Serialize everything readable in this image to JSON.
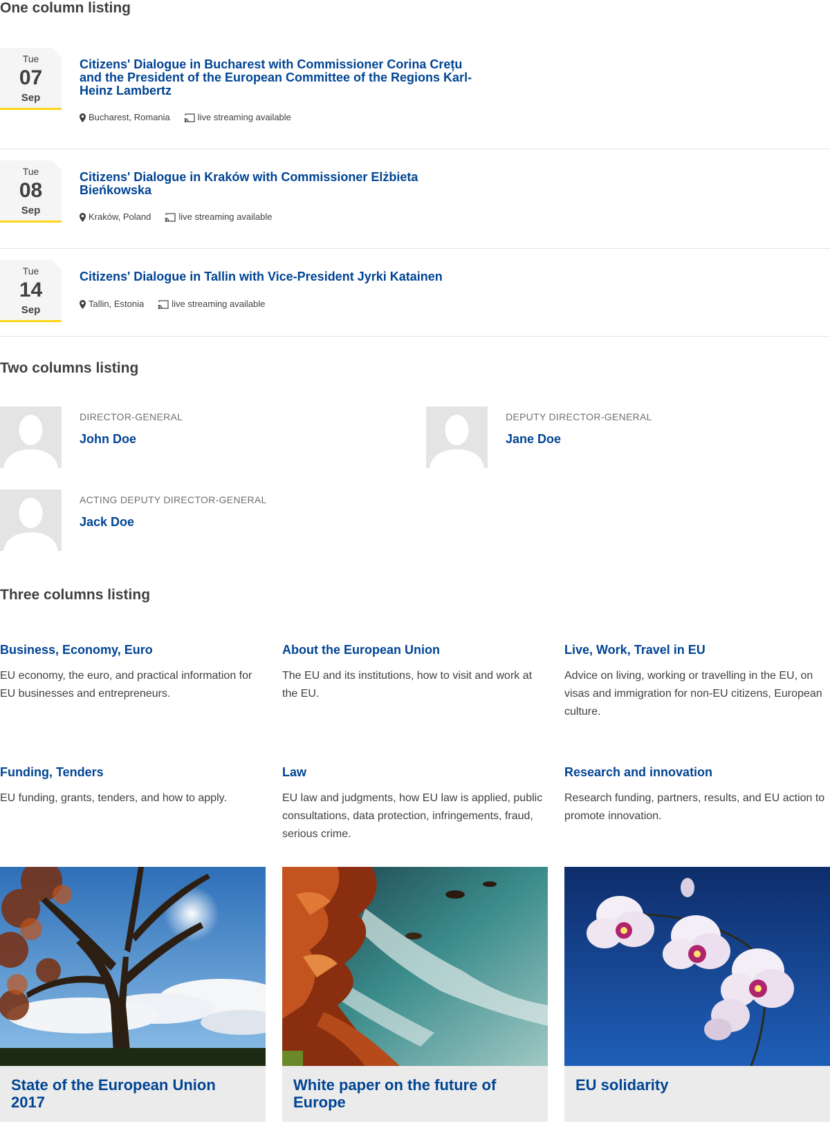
{
  "sections": {
    "one_column": "One column listing",
    "two_columns": "Two columns listing",
    "three_columns": "Three columns listing"
  },
  "events": [
    {
      "dow": "Tue",
      "day": "07",
      "month": "Sep",
      "title": "Citizens' Dialogue in Bucharest with Commissioner Corina Crețu and the President of the European Committee of the Regions Karl-Heinz Lambertz",
      "location": "Bucharest, Romania",
      "streaming": "live streaming available"
    },
    {
      "dow": "Tue",
      "day": "08",
      "month": "Sep",
      "title": "Citizens' Dialogue in Kraków with Commissioner Elżbieta Bieńkowska",
      "location": "Kraków, Poland",
      "streaming": "live streaming available"
    },
    {
      "dow": "Tue",
      "day": "14",
      "month": "Sep",
      "title": "Citizens' Dialogue in Tallin with Vice-President Jyrki Katainen",
      "location": "Tallin, Estonia",
      "streaming": "live streaming available"
    }
  ],
  "people": [
    {
      "role": "Director-General",
      "name": "John Doe"
    },
    {
      "role": "Deputy Director-General",
      "name": "Jane Doe"
    },
    {
      "role": "Acting Deputy Director-General",
      "name": "Jack Doe"
    }
  ],
  "topics": [
    {
      "title": "Business, Economy, Euro",
      "desc": "EU economy, the euro, and practical information for EU businesses and entrepreneurs."
    },
    {
      "title": "About the European Union",
      "desc": "The EU and its institutions, how to visit and work at the EU."
    },
    {
      "title": "Live, Work, Travel in EU",
      "desc": "Advice on living, working or travelling in the EU, on visas and immigration for non-EU citizens, European culture."
    },
    {
      "title": "Funding, Tenders",
      "desc": "EU funding, grants, tenders, and how to apply."
    },
    {
      "title": "Law",
      "desc": "EU law and judgments, how EU law is applied, public consultations, data protection, infringements, fraud, serious crime."
    },
    {
      "title": "Research and innovation",
      "desc": "Research funding, partners, results, and EU action to promote innovation."
    }
  ],
  "cards": [
    {
      "title": "State of the European Union 2017"
    },
    {
      "title": "White paper on the future of Europe"
    },
    {
      "title": "EU solidarity"
    }
  ],
  "colors": {
    "link": "#004494",
    "accent_yellow": "#ffd617",
    "text": "#404040"
  }
}
